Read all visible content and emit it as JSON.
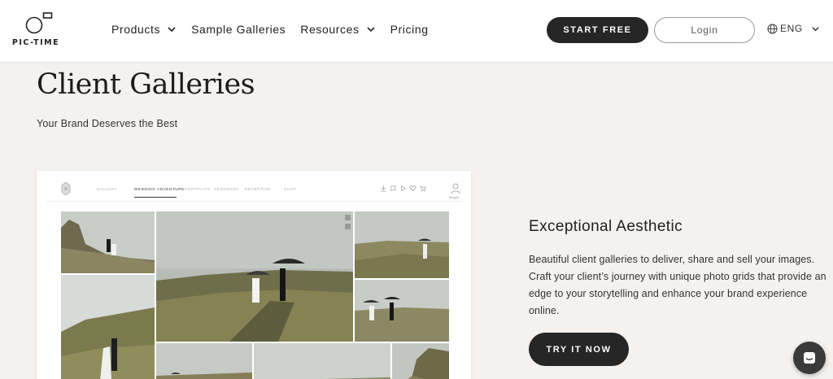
{
  "header": {
    "logo_text": "PIC-TIME",
    "nav": [
      {
        "label": "Products",
        "has_dropdown": true
      },
      {
        "label": "Sample Galleries",
        "has_dropdown": false
      },
      {
        "label": "Resources",
        "has_dropdown": true
      },
      {
        "label": "Pricing",
        "has_dropdown": false
      }
    ],
    "start_free_label": "START FREE",
    "login_label": "Login",
    "language_label": "ENG"
  },
  "hero": {
    "title": "Client Galleries",
    "subtitle": "Your Brand Deserves the Best"
  },
  "gallery_mock": {
    "tabs": [
      "GALLERY",
      "WEDDING ADVENTURE",
      "PORTRAITS",
      "CEREMONY",
      "RECEPTION",
      "SHOP"
    ],
    "active_tab": "WEDDING ADVENTURE",
    "user_label": "Morgan..."
  },
  "feature": {
    "title": "Exceptional Aesthetic",
    "body": "Beautiful client galleries to deliver, share and sell your images. Craft your client’s journey with unique photo grids that provide an edge to your storytelling and enhance your brand experience online.",
    "cta_label": "TRY IT NOW"
  },
  "colors": {
    "page_bg": "#f4f1ee",
    "dark_button": "#262626",
    "header_bg": "#ffffff"
  }
}
